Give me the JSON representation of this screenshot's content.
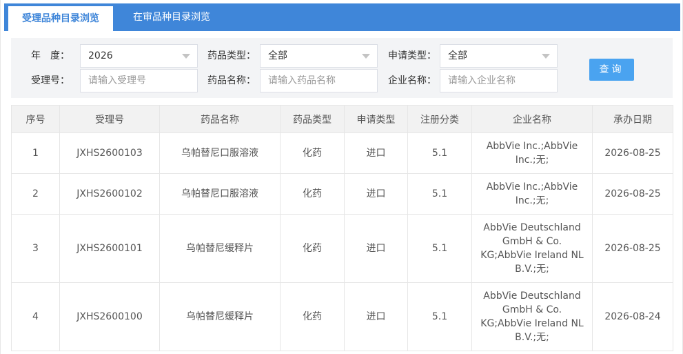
{
  "tabs": [
    {
      "label": "受理品种目录浏览",
      "active": true
    },
    {
      "label": "在审品种目录浏览",
      "active": false
    }
  ],
  "filters": {
    "year_label": "年　度：",
    "year_value": "2026",
    "drug_type_label": "药品类型：",
    "drug_type_value": "全部",
    "apply_type_label": "申请类型：",
    "apply_type_value": "全部",
    "accept_no_label": "受理号：",
    "accept_no_placeholder": "请输入受理号",
    "drug_name_label": "药品名称：",
    "drug_name_placeholder": "请输入药品名称",
    "company_label": "企业名称：",
    "company_placeholder": "请输入企业名称",
    "query_button": "查询"
  },
  "table": {
    "headers": [
      "序号",
      "受理号",
      "药品名称",
      "药品类型",
      "申请类型",
      "注册分类",
      "企业名称",
      "承办日期"
    ],
    "rows": [
      {
        "no": "1",
        "accept_no": "JXHS2600103",
        "drug_name": "乌帕替尼口服溶液",
        "drug_type": "化药",
        "apply_type": "进口",
        "reg_class": "5.1",
        "company": "AbbVie Inc.;AbbVie Inc.;无;",
        "date": "2026-08-25"
      },
      {
        "no": "2",
        "accept_no": "JXHS2600102",
        "drug_name": "乌帕替尼口服溶液",
        "drug_type": "化药",
        "apply_type": "进口",
        "reg_class": "5.1",
        "company": "AbbVie Inc.;AbbVie Inc.;无;",
        "date": "2026-08-25"
      },
      {
        "no": "3",
        "accept_no": "JXHS2600101",
        "drug_name": "乌帕替尼缓释片",
        "drug_type": "化药",
        "apply_type": "进口",
        "reg_class": "5.1",
        "company": "AbbVie Deutschland GmbH & Co. KG;AbbVie Ireland NL B.V.;无;",
        "date": "2026-08-25"
      },
      {
        "no": "4",
        "accept_no": "JXHS2600100",
        "drug_name": "乌帕替尼缓释片",
        "drug_type": "化药",
        "apply_type": "进口",
        "reg_class": "5.1",
        "company": "AbbVie Deutschland GmbH & Co. KG;AbbVie Ireland NL B.V.;无;",
        "date": "2026-08-24"
      }
    ]
  },
  "colors": {
    "accent": "#3f86d9",
    "button": "#4aa3f0"
  }
}
